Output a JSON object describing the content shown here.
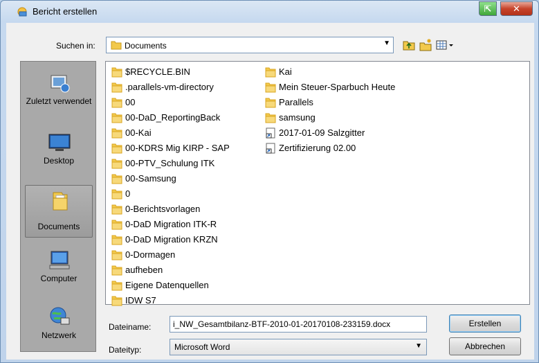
{
  "window": {
    "title": "Bericht erstellen",
    "close_symbol": "✕",
    "restore_symbol": "⇱"
  },
  "toolbar": {
    "lookin_label": "Suchen in:",
    "lookin_value": "Documents",
    "icons": [
      "up-folder-icon",
      "new-folder-icon",
      "view-menu-icon"
    ]
  },
  "places": [
    {
      "label": "Zuletzt verwendet",
      "icon": "recent-icon"
    },
    {
      "label": "Desktop",
      "icon": "desktop-icon"
    },
    {
      "label": "Documents",
      "icon": "documents-icon",
      "selected": true
    },
    {
      "label": "Computer",
      "icon": "computer-icon"
    },
    {
      "label": "Netzwerk",
      "icon": "network-icon"
    }
  ],
  "files": {
    "column1": [
      "$RECYCLE.BIN",
      ".parallels-vm-directory",
      "00",
      "00-DaD_ReportingBack",
      "00-Kai",
      "00-KDRS Mig KIRP - SAP",
      "00-PTV_Schulung ITK",
      "00-Samsung",
      "0",
      "0-Berichtsvorlagen",
      "0-DaD Migration ITK-R",
      "0-DaD Migration KRZN",
      "0-Dormagen",
      "aufheben",
      "Eigene Datenquellen",
      "IDW S7"
    ],
    "column2": [
      {
        "name": "Kai",
        "type": "folder"
      },
      {
        "name": "Mein Steuer-Sparbuch Heute",
        "type": "folder"
      },
      {
        "name": "Parallels",
        "type": "folder"
      },
      {
        "name": "samsung",
        "type": "folder"
      },
      {
        "name": "2017-01-09 Salzgitter",
        "type": "shortcut"
      },
      {
        "name": "Zertifizierung 02.00",
        "type": "shortcut"
      }
    ]
  },
  "bottom": {
    "filename_label": "Dateiname:",
    "filename_value": "i_NW_Gesamtbilanz-BTF-2010-01-20170108-233159.docx",
    "filetype_label": "Dateityp:",
    "filetype_value": "Microsoft Word",
    "create_button": "Erstellen",
    "cancel_button": "Abbrechen"
  },
  "colors": {
    "folder": "#f2c94c",
    "folder_dark": "#d9a520",
    "selection": "#a0a0a0"
  }
}
